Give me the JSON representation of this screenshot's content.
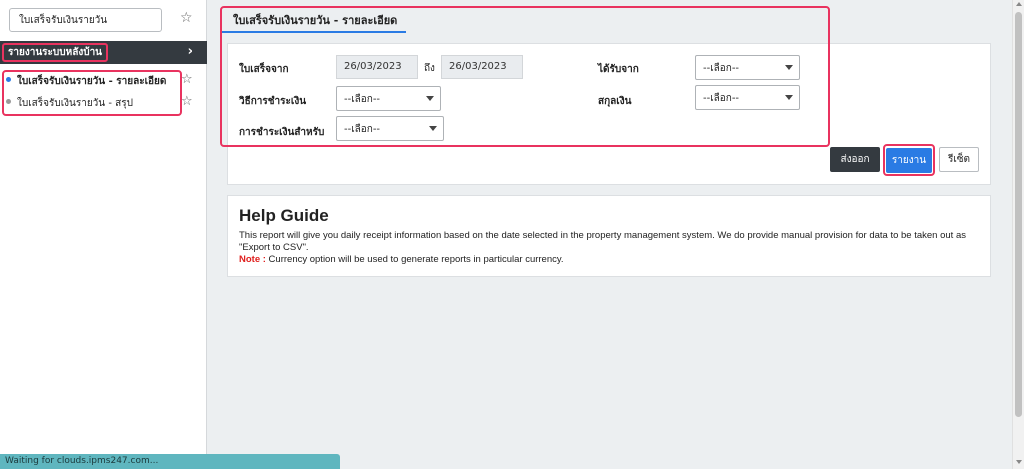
{
  "sidebar": {
    "search_value": "ใบเสร็จรับเงินรายวัน",
    "group_header": "รายงานระบบหลังบ้าน",
    "items": [
      {
        "label": "ใบเสร็จรับเงินรายวัน - รายละเอียด",
        "active": true
      },
      {
        "label": "ใบเสร็จรับเงินรายวัน - สรุป",
        "active": false
      }
    ]
  },
  "tab": {
    "label": "ใบเสร็จรับเงินรายวัน - รายละเอียด"
  },
  "filters": {
    "receipt_from_label": "ใบเสร็จจาก",
    "date_from": "26/03/2023",
    "to_label": "ถึง",
    "date_to": "26/03/2023",
    "received_from_label": "ได้รับจาก",
    "payment_method_label": "วิธีการชำระเงิน",
    "currency_label": "สกุลเงิน",
    "payment_for_label": "การชำระเงินสำหรับ",
    "select_placeholder": "--เลือก--"
  },
  "buttons": {
    "export": "ส่งออก",
    "report": "รายงาน",
    "reset": "รีเซ็ต"
  },
  "help": {
    "title": "Help Guide",
    "body": "This report will give you daily receipt information based on the date selected in the property management system. We do provide manual provision for data to be taken out as \"Export to CSV\".",
    "note_label": "Note :",
    "note_text": " Currency option will be used to generate reports in particular currency."
  },
  "status": "Waiting for clouds.ipms247.com...",
  "colors": {
    "accent": "#2a7be4",
    "dark": "#343a40",
    "highlight": "#e9335f",
    "note": "#e0201e",
    "status_bar": "#5fb6bf"
  },
  "icons": {
    "favorite": "star-outline-icon",
    "expand": "chevron-right-icon",
    "dropdown": "caret-down-icon"
  }
}
